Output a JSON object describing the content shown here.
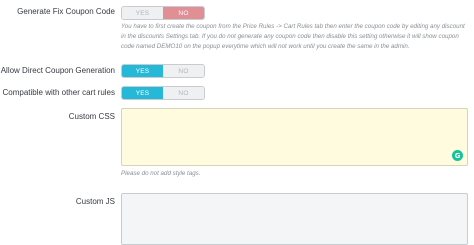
{
  "fix_coupon": {
    "label": "Generate Fix Coupon Code",
    "yes": "YES",
    "no": "NO",
    "selected": "NO",
    "help": "You have to first create the coupon from the Price Rules -> Cart Rules tab then enter the coupon code by editing any discount in the discounts Settings tab. If you do not generate any coupon code then disable this setting otherwise it will show coupon code named DEMO10 on the popup everytime which will not work until you create the same in the admin."
  },
  "direct_coupon": {
    "label": "Allow Direct Coupon Generation",
    "yes": "YES",
    "no": "NO",
    "selected": "YES"
  },
  "compatible_rules": {
    "label": "Compatible with other cart rules",
    "yes": "YES",
    "no": "NO",
    "selected": "YES"
  },
  "custom_css": {
    "label": "Custom CSS",
    "value": "",
    "help": "Please do not add style tags.",
    "grammarly_icon": "grammarly-icon"
  },
  "custom_js": {
    "label": "Custom JS",
    "value": ""
  },
  "colors": {
    "toggle_yes_active": "#25b9d7",
    "toggle_no_active": "#e08f95",
    "css_background": "#fffbdf",
    "grammarly": "#15c39a"
  }
}
